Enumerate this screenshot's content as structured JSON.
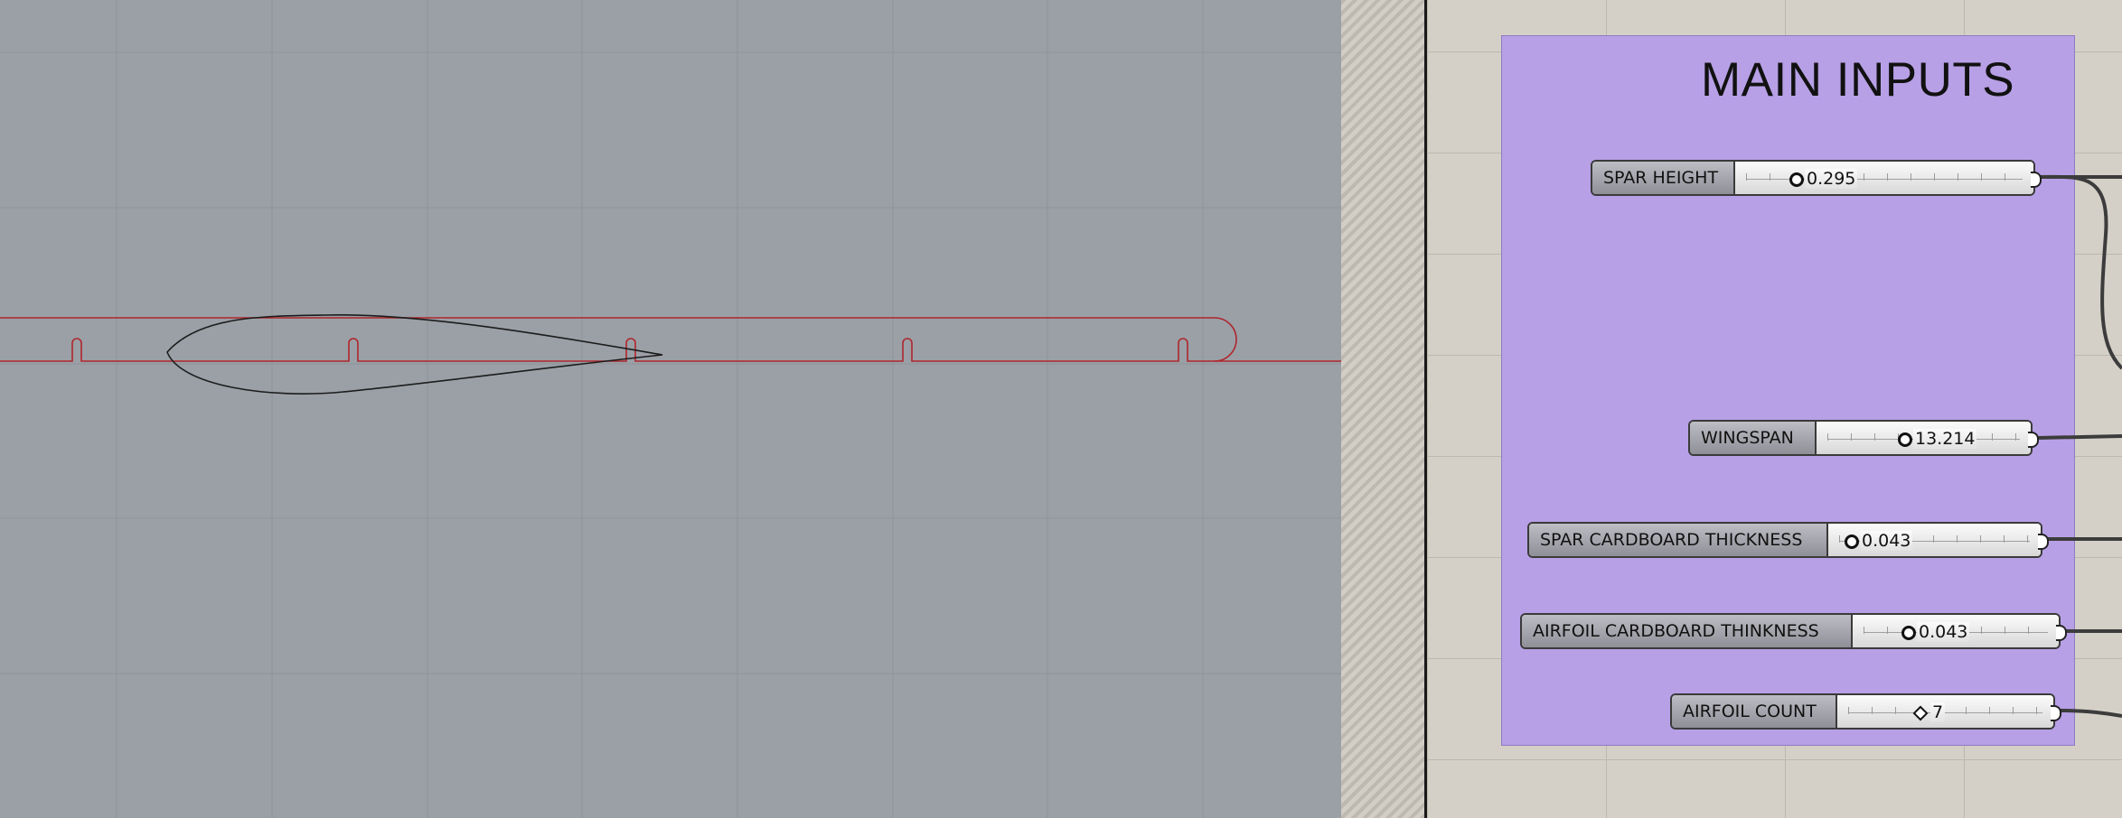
{
  "colors": {
    "viewport_bg": "#9aa0a6",
    "cut_line": "#b0252c",
    "airfoil_line": "#1c1c1c",
    "canvas_bg": "#d4d0c8",
    "group_fill": "#b7a0e6",
    "wire": "#3c3c3c"
  },
  "group": {
    "title": "MAIN INPUTS"
  },
  "sliders": [
    {
      "name": "SPAR HEIGHT",
      "value": "0.295",
      "grip": "circle"
    },
    {
      "name": "WINGSPAN",
      "value": "13.214",
      "grip": "circle"
    },
    {
      "name": "SPAR CARDBOARD THICKNESS",
      "value": "0.043",
      "grip": "circle"
    },
    {
      "name": "AIRFOIL CARDBOARD THINKNESS",
      "value": "0.043",
      "grip": "circle"
    },
    {
      "name": "AIRFOIL COUNT",
      "value": "7",
      "grip": "diamond"
    }
  ]
}
